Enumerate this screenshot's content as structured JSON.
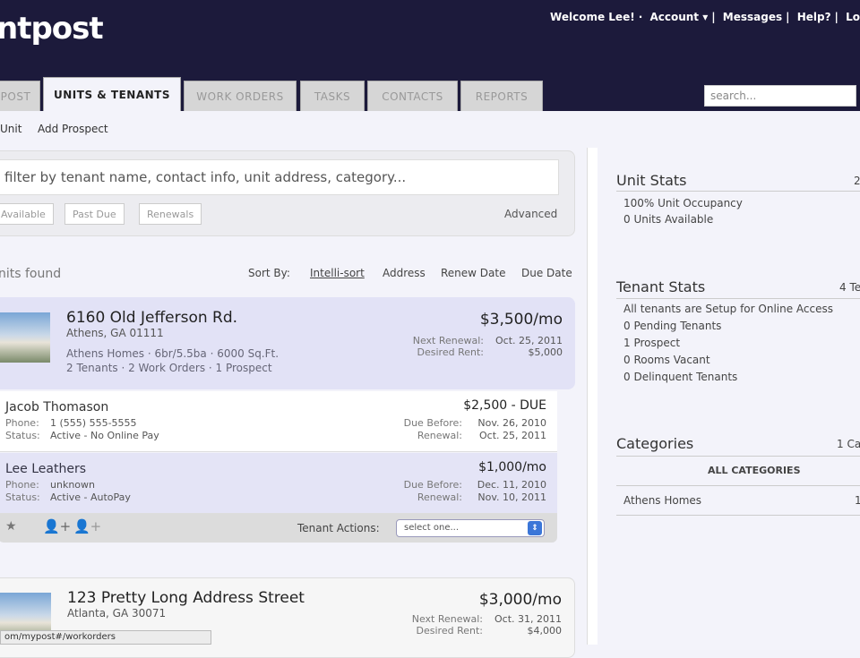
{
  "header": {
    "logo": "ntpost",
    "welcome": "Welcome Lee!",
    "account": "Account ▾",
    "messages": "Messages",
    "help": "Help?",
    "logout": "Lo"
  },
  "tabs": [
    "POST",
    "UNITS & TENANTS",
    "WORK ORDERS",
    "TASKS",
    "CONTACTS",
    "REPORTS"
  ],
  "search_placeholder": "search...",
  "subnav": [
    "Unit",
    "Add Prospect"
  ],
  "filter": {
    "placeholder": "filter by tenant name, contact info, unit address, category...",
    "chips": [
      "Available",
      "Past Due",
      "Renewals"
    ],
    "advanced": "Advanced"
  },
  "results": {
    "found": "nits found",
    "sort_by": "Sort By:",
    "sorts": [
      "Intelli-sort",
      "Address",
      "Renew Date",
      "Due Date"
    ]
  },
  "units": [
    {
      "address": "6160 Old Jefferson Rd.",
      "city": "Athens, GA 01111",
      "details": "Athens Homes  ·  6br/5.5ba  ·  6000 Sq.Ft.",
      "counts": "2 Tenants  ·  2 Work Orders  ·  1 Prospect",
      "price": "$3,500/mo",
      "renewal_label": "Next Renewal:",
      "renewal": "Oct. 25, 2011",
      "desired_label": "Desired Rent:",
      "desired": "$5,000"
    },
    {
      "address": "123 Pretty Long Address Street",
      "city": "Atlanta, GA 30071",
      "price": "$3,000/mo",
      "renewal_label": "Next Renewal:",
      "renewal": "Oct. 31, 2011",
      "desired_label": "Desired Rent:",
      "desired": "$4,000"
    }
  ],
  "tenants": [
    {
      "name": "Jacob Thomason",
      "phone_label": "Phone:",
      "phone": "1 (555) 555-5555",
      "status_label": "Status:",
      "status": "Active - No Online Pay",
      "amount": "$2,500 - DUE",
      "due_label": "Due Before:",
      "due": "Nov. 26, 2010",
      "renewal_label": "Renewal:",
      "renewal": "Oct. 25, 2011"
    },
    {
      "name": "Lee Leathers",
      "phone_label": "Phone:",
      "phone": "unknown",
      "status_label": "Status:",
      "status": "Active - AutoPay",
      "amount": "$1,000/mo",
      "due_label": "Due Before:",
      "due": "Dec. 11, 2010",
      "renewal_label": "Renewal:",
      "renewal": "Nov. 10, 2011"
    }
  ],
  "tenant_actions": {
    "label": "Tenant Actions:",
    "select": "select one..."
  },
  "right": {
    "unit_stats": {
      "title": "Unit Stats",
      "count": "2",
      "items": [
        "100% Unit Occupancy",
        "0 Units Available"
      ]
    },
    "tenant_stats": {
      "title": "Tenant Stats",
      "count": "4 Te",
      "items": [
        "All tenants are Setup for Online Access",
        "0 Pending Tenants",
        "1 Prospect",
        "0 Rooms Vacant",
        "0 Delinquent Tenants"
      ]
    },
    "categories": {
      "title": "Categories",
      "count": "1 Ca",
      "all": "ALL CATEGORIES",
      "items": [
        {
          "name": "Athens Homes",
          "count": "1"
        }
      ]
    }
  },
  "statusbar": "om/mypost#/workorders"
}
